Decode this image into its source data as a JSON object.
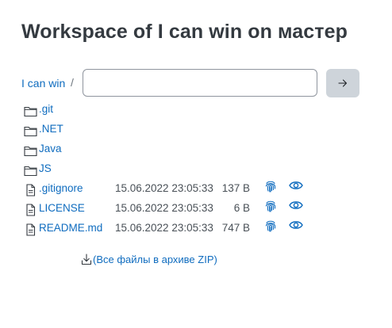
{
  "page": {
    "title": "Workspace of I can win on мастер"
  },
  "path": {
    "crumb": "I can win",
    "separator": "/",
    "input_value": "",
    "go_icon": "arrow-right-icon"
  },
  "entries": [
    {
      "type": "folder",
      "icon": "folder-icon",
      "name": ".git"
    },
    {
      "type": "folder",
      "icon": "folder-icon",
      "name": ".NET"
    },
    {
      "type": "folder",
      "icon": "folder-icon",
      "name": "Java"
    },
    {
      "type": "folder",
      "icon": "folder-icon",
      "name": "JS"
    },
    {
      "type": "file",
      "icon": "file-icon",
      "name": ".gitignore",
      "date": "15.06.2022 23:05:33",
      "size": "137 B"
    },
    {
      "type": "file",
      "icon": "file-icon",
      "name": "LICENSE",
      "date": "15.06.2022 23:05:33",
      "size": "6 B"
    },
    {
      "type": "file",
      "icon": "file-icon",
      "name": "README.md",
      "date": "15.06.2022 23:05:33",
      "size": "747 B"
    }
  ],
  "file_actions": {
    "fingerprint_icon": "fingerprint-icon",
    "view_icon": "eye-icon"
  },
  "zip": {
    "label": "(Все файлы в архиве ZIP)",
    "icon": "download-icon"
  },
  "colors": {
    "link": "#0f6cbf",
    "title": "#343a40",
    "button_bg": "#ced4da"
  }
}
